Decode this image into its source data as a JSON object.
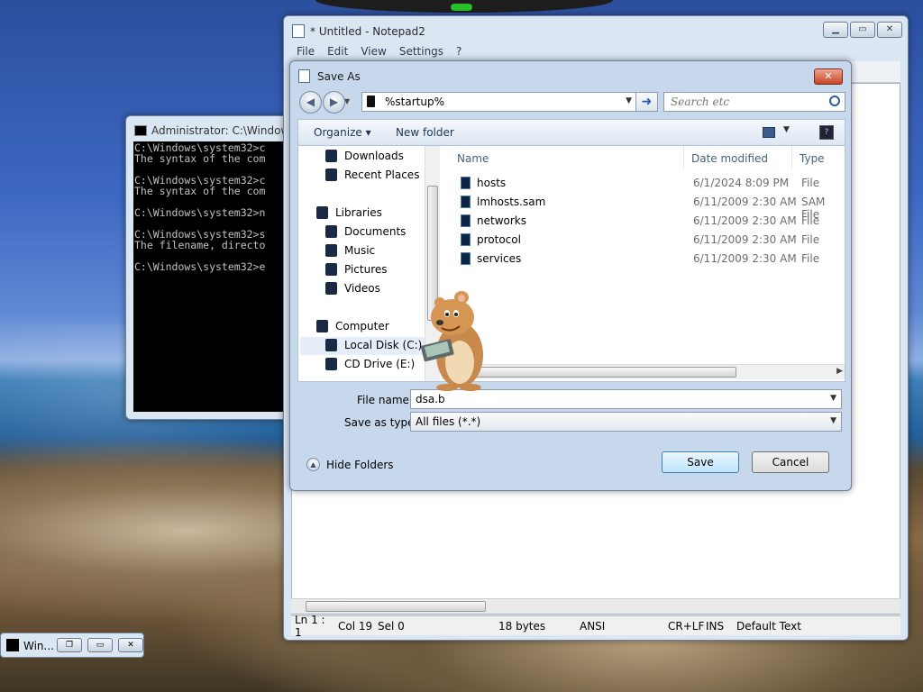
{
  "desktop": {},
  "console": {
    "title": "Administrator: C:\\Windows",
    "lines": [
      "C:\\Windows\\system32>c",
      "The syntax of the com",
      "",
      "C:\\Windows\\system32>c",
      "The syntax of the com",
      "",
      "C:\\Windows\\system32>n",
      "",
      "C:\\Windows\\system32>s",
      "The filename, directo",
      "",
      "C:\\Windows\\system32>e"
    ]
  },
  "minimized": {
    "title": "Win..."
  },
  "notepad": {
    "title": "* Untitled - Notepad2",
    "menu": [
      "File",
      "Edit",
      "View",
      "Settings",
      "?"
    ],
    "status": {
      "position": "Ln 1 : 1",
      "col": "Col 19",
      "sel": "Sel 0",
      "size": "18 bytes",
      "encoding": "ANSI",
      "eol": "CR+LF",
      "ins": "INS",
      "scheme": "Default Text"
    }
  },
  "dialog": {
    "title": "Save As",
    "address": "%startup%",
    "search_placeholder": "Search etc",
    "organize": "Organize",
    "new_folder": "New folder",
    "nav": [
      {
        "label": "Downloads",
        "icon": "downloads-icon"
      },
      {
        "label": "Recent Places",
        "icon": "recent-places-icon"
      },
      {
        "label": "Libraries",
        "icon": "libraries-icon"
      },
      {
        "label": "Documents",
        "icon": "documents-icon"
      },
      {
        "label": "Music",
        "icon": "music-icon"
      },
      {
        "label": "Pictures",
        "icon": "pictures-icon"
      },
      {
        "label": "Videos",
        "icon": "videos-icon"
      },
      {
        "label": "Computer",
        "icon": "computer-icon"
      },
      {
        "label": "Local Disk (C:)",
        "icon": "drive-icon"
      },
      {
        "label": "CD Drive (E:)",
        "icon": "cd-drive-icon"
      }
    ],
    "columns": {
      "name": "Name",
      "date": "Date modified",
      "type": "Type"
    },
    "files": [
      {
        "name": "hosts",
        "date": "6/1/2024 8:09 PM",
        "type": "File"
      },
      {
        "name": "lmhosts.sam",
        "date": "6/11/2009 2:30 AM",
        "type": "SAM File"
      },
      {
        "name": "networks",
        "date": "6/11/2009 2:30 AM",
        "type": "File"
      },
      {
        "name": "protocol",
        "date": "6/11/2009 2:30 AM",
        "type": "File"
      },
      {
        "name": "services",
        "date": "6/11/2009 2:30 AM",
        "type": "File"
      }
    ],
    "filename_label": "File name:",
    "filename_value": "dsa.b",
    "type_label": "Save as type:",
    "type_value": "All files (*.*)",
    "hide_folders": "Hide Folders",
    "save": "Save",
    "cancel": "Cancel"
  }
}
